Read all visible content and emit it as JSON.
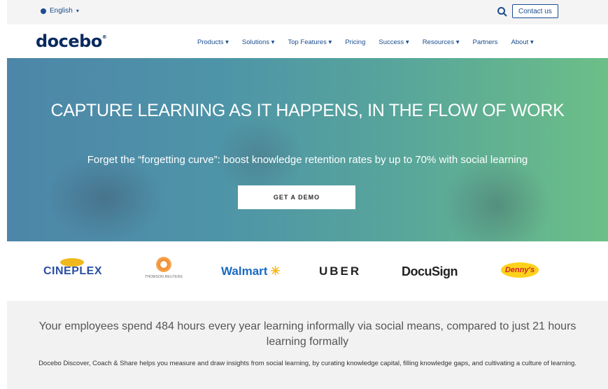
{
  "topbar": {
    "language": "English",
    "contact_label": "Contact us"
  },
  "navbar": {
    "logo": "docebo",
    "logo_mark": "®",
    "items": [
      "Products",
      "Solutions",
      "Top Features",
      "Pricing",
      "Success",
      "Resources",
      "Partners",
      "About"
    ],
    "dropdown_items": [
      true,
      true,
      true,
      false,
      true,
      true,
      false,
      true
    ]
  },
  "hero": {
    "title": "CAPTURE LEARNING AS IT HAPPENS, IN THE FLOW OF WORK",
    "subtitle": "Forget the “forgetting curve”: boost knowledge retention rates by up to 70% with social learning",
    "cta_label": "GET A DEMO"
  },
  "customers": {
    "cineplex": "CINEPLEX",
    "thomson": "THOMSON REUTERS",
    "walmart": "Walmart",
    "uber": "UBER",
    "docusign": "DocuSign",
    "dennys": "Denny's"
  },
  "stats": {
    "headline": "Your employees spend 484 hours every year learning informally via social means, compared to just 21 hours learning formally",
    "body": "Docebo Discover, Coach & Share helps you measure and draw insights from social learning, by curating knowledge capital, filling knowledge gaps, and cultivating a culture of learning."
  },
  "colors": {
    "brand": "#0a2a5e",
    "link": "#1b4d8f",
    "hero_start": "#4d86a8",
    "hero_end": "#6cbf87"
  }
}
